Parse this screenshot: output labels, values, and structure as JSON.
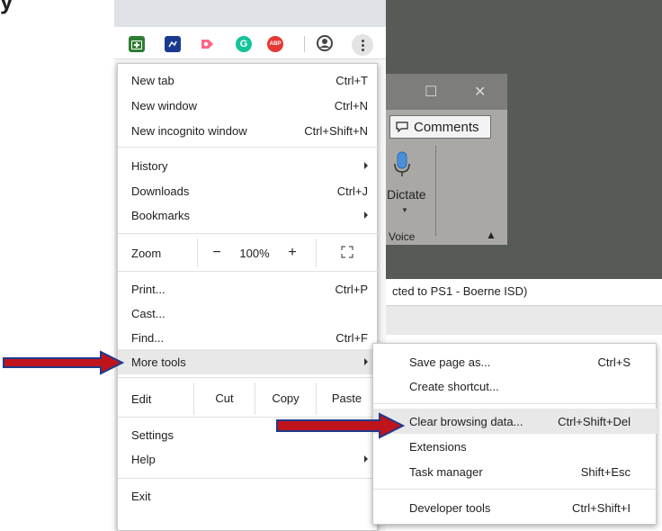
{
  "background_partial_text": "y",
  "word_window": {
    "comments_label": "Comments",
    "dictate_label": "Dictate",
    "voice_label": "Voice",
    "status_text": "cted to PS1 - Boerne ISD)"
  },
  "toolbar": {
    "extensions": [
      {
        "name": "green-extension-icon",
        "color": "#2e7d32",
        "text": ""
      },
      {
        "name": "blue-extension-icon",
        "color": "#1a3a8f",
        "text": ""
      },
      {
        "name": "pink-extension-icon",
        "color": "#ff6688",
        "text": ""
      },
      {
        "name": "grammarly-icon",
        "color": "#15c39a",
        "text": "G"
      },
      {
        "name": "adblock-icon",
        "color": "#e53935",
        "text": "ABP"
      }
    ]
  },
  "menu": {
    "new_tab": {
      "label": "New tab",
      "shortcut": "Ctrl+T"
    },
    "new_window": {
      "label": "New window",
      "shortcut": "Ctrl+N"
    },
    "new_incognito": {
      "label": "New incognito window",
      "shortcut": "Ctrl+Shift+N"
    },
    "history": {
      "label": "History"
    },
    "downloads": {
      "label": "Downloads",
      "shortcut": "Ctrl+J"
    },
    "bookmarks": {
      "label": "Bookmarks"
    },
    "zoom": {
      "label": "Zoom",
      "minus": "−",
      "value": "100%",
      "plus": "+"
    },
    "print": {
      "label": "Print...",
      "shortcut": "Ctrl+P"
    },
    "cast": {
      "label": "Cast..."
    },
    "find": {
      "label": "Find...",
      "shortcut": "Ctrl+F"
    },
    "more_tools": {
      "label": "More tools"
    },
    "edit": {
      "label": "Edit",
      "cut": "Cut",
      "copy": "Copy",
      "paste": "Paste"
    },
    "settings": {
      "label": "Settings"
    },
    "help": {
      "label": "Help"
    },
    "exit": {
      "label": "Exit"
    }
  },
  "submenu": {
    "save_page": {
      "label": "Save page as...",
      "shortcut": "Ctrl+S"
    },
    "create_shortcut": {
      "label": "Create shortcut..."
    },
    "clear_browsing": {
      "label": "Clear browsing data...",
      "shortcut": "Ctrl+Shift+Del"
    },
    "extensions": {
      "label": "Extensions"
    },
    "task_manager": {
      "label": "Task manager",
      "shortcut": "Shift+Esc"
    },
    "developer_tools": {
      "label": "Developer tools",
      "shortcut": "Ctrl+Shift+I"
    }
  },
  "colors": {
    "arrow_fill": "#c0141c",
    "arrow_outline": "#1f3a8a",
    "highlight": "#e8e8e8"
  }
}
